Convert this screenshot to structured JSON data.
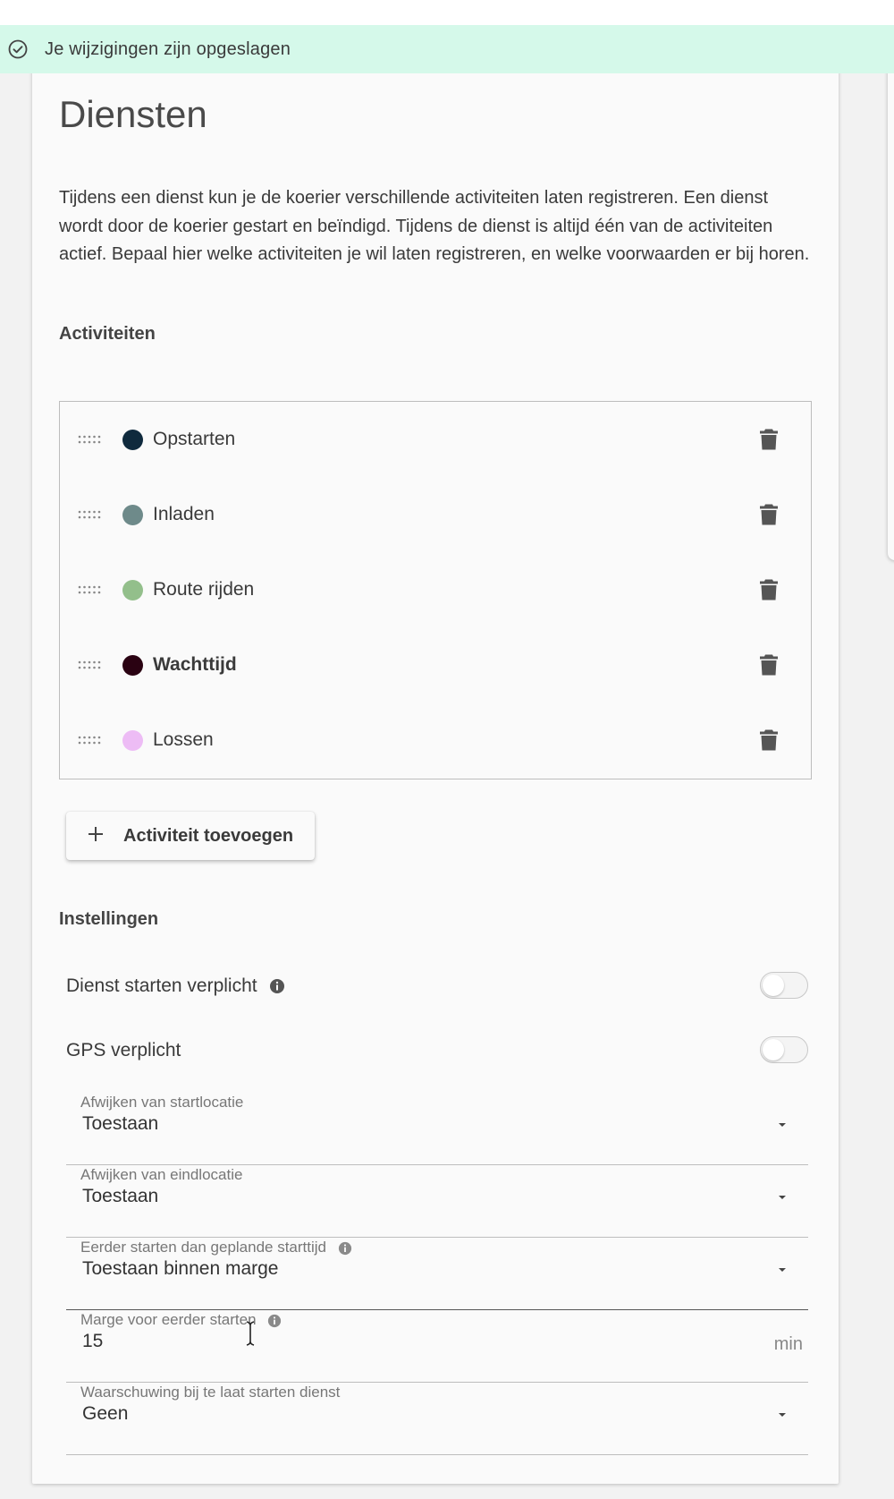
{
  "notification": {
    "message": "Je wijzigingen zijn opgeslagen",
    "icon": "check-circle-icon"
  },
  "page": {
    "title": "Diensten",
    "intro": "Tijdens een dienst kun je de koerier verschillende activiteiten laten registreren. Een dienst wordt door de koerier gestart en beïndigd. Tijdens de dienst is altijd één van de activiteiten actief. Bepaal hier welke activiteiten je wil laten registreren, en welke voorwaarden er bij horen."
  },
  "activities": {
    "heading": "Activiteiten",
    "items": [
      {
        "label": "Opstarten",
        "color": "#0f2a3d",
        "bold": false
      },
      {
        "label": "Inladen",
        "color": "#6e8a8a",
        "bold": false
      },
      {
        "label": "Route rijden",
        "color": "#93bf8b",
        "bold": false
      },
      {
        "label": "Wachttijd",
        "color": "#2a0212",
        "bold": true
      },
      {
        "label": "Lossen",
        "color": "#edbcf5",
        "bold": false
      }
    ],
    "add_label": "Activiteit toevoegen"
  },
  "settings": {
    "heading": "Instellingen",
    "dienst_starten": {
      "label": "Dienst starten verplicht",
      "enabled": false
    },
    "gps": {
      "label": "GPS verplicht",
      "enabled": false
    },
    "startlocatie": {
      "label": "Afwijken van startlocatie",
      "value": "Toestaan"
    },
    "eindlocatie": {
      "label": "Afwijken van eindlocatie",
      "value": "Toestaan"
    },
    "eerder_starten": {
      "label": "Eerder starten dan geplande starttijd",
      "value": "Toestaan binnen marge"
    },
    "marge": {
      "label": "Marge voor eerder starten",
      "value": "15",
      "unit": "min"
    },
    "waarschuwing": {
      "label": "Waarschuwing bij te laat starten dienst",
      "value": "Geen"
    }
  }
}
